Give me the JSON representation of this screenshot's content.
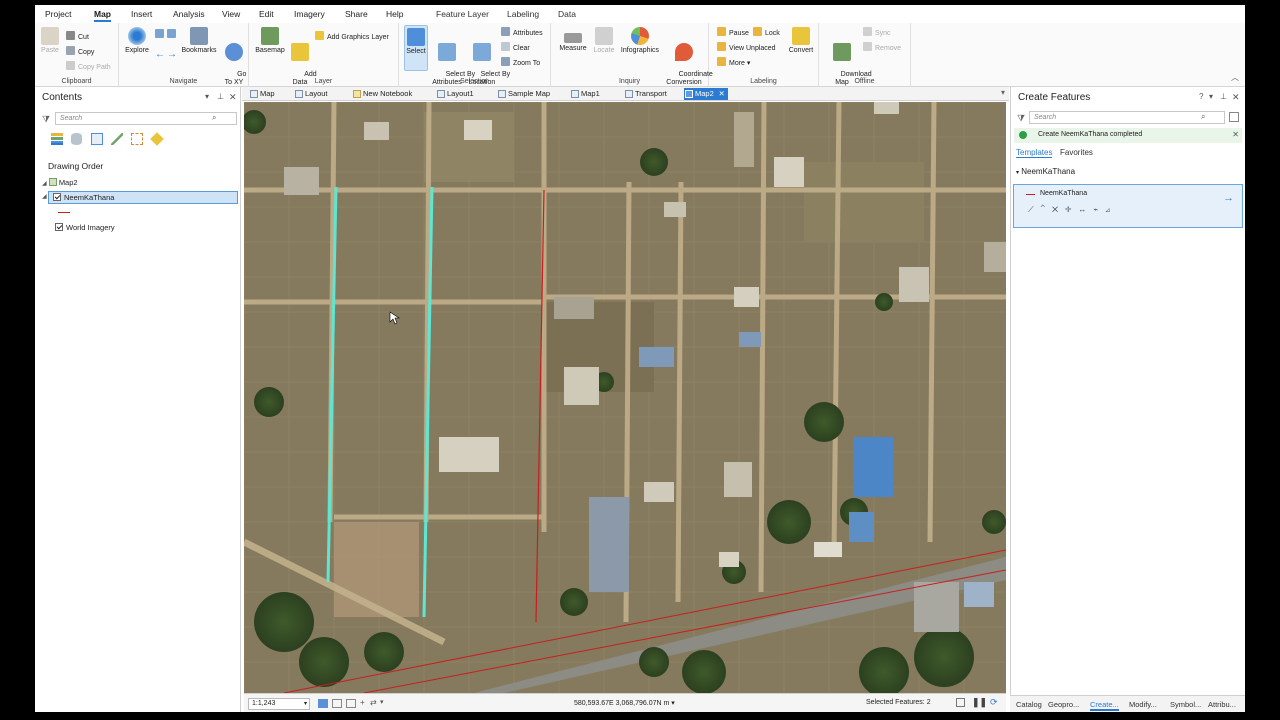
{
  "menu": {
    "tabs": [
      "Project",
      "Map",
      "Insert",
      "Analysis",
      "View",
      "Edit",
      "Imagery",
      "Share",
      "Help",
      "Feature Layer",
      "Labeling",
      "Data"
    ],
    "active": "Map"
  },
  "ribbon": {
    "clipboard": {
      "label": "Clipboard",
      "paste": "Paste",
      "cut": "Cut",
      "copy": "Copy",
      "copy_path": "Copy Path"
    },
    "navigate": {
      "label": "Navigate",
      "explore": "Explore",
      "bookmarks": "Bookmarks",
      "go_to_xy": "Go\nTo XY"
    },
    "layer": {
      "label": "Layer",
      "basemap": "Basemap",
      "add_data": "Add\nData",
      "add_graphics": "Add Graphics Layer"
    },
    "selection": {
      "label": "Selection",
      "select": "Select",
      "select_by_attributes": "Select By\nAttributes",
      "select_by_location": "Select By\nLocation",
      "attributes": "Attributes",
      "clear": "Clear",
      "zoom_to": "Zoom To"
    },
    "inquiry": {
      "label": "Inquiry",
      "measure": "Measure",
      "locate": "Locate",
      "infographics": "Infographics",
      "coordinate_conversion": "Coordinate\nConversion"
    },
    "labeling": {
      "label": "Labeling",
      "pause": "Pause",
      "lock": "Lock",
      "view_unplaced": "View Unplaced",
      "more": "More",
      "convert": "Convert"
    },
    "offline": {
      "label": "Offline",
      "download_map": "Download\nMap",
      "sync": "Sync",
      "remove": "Remove"
    }
  },
  "contents": {
    "title": "Contents",
    "search_placeholder": "Search",
    "drawing_order": "Drawing Order",
    "map_name": "Map2",
    "layers": [
      "NeemKaThana",
      "World Imagery"
    ]
  },
  "view_tabs": [
    "Map",
    "Layout",
    "New Notebook",
    "Layout1",
    "Sample Map",
    "Map1",
    "Transport",
    "Map2"
  ],
  "active_view_tab": "Map2",
  "status": {
    "scale": "1:1,243",
    "coordinates": "580,593.67E 3,068,796.07N m",
    "selected_features": "Selected Features: 2"
  },
  "create_features": {
    "title": "Create Features",
    "search_placeholder": "Search",
    "message": "Create NeemKaThana completed",
    "tab_templates": "Templates",
    "tab_favorites": "Favorites",
    "group": "NeemKaThana",
    "template": "NeemKaThana"
  },
  "bottom_tabs": [
    "Catalog",
    "Geopro...",
    "Create...",
    "Modify...",
    "Symbol...",
    "Attribu..."
  ],
  "active_bottom_tab": "Create...",
  "colors": {
    "accent": "#2b7bd3",
    "line_red": "#c81e1e",
    "line_cyan": "#5ee6d2",
    "success": "#2e9e46"
  }
}
